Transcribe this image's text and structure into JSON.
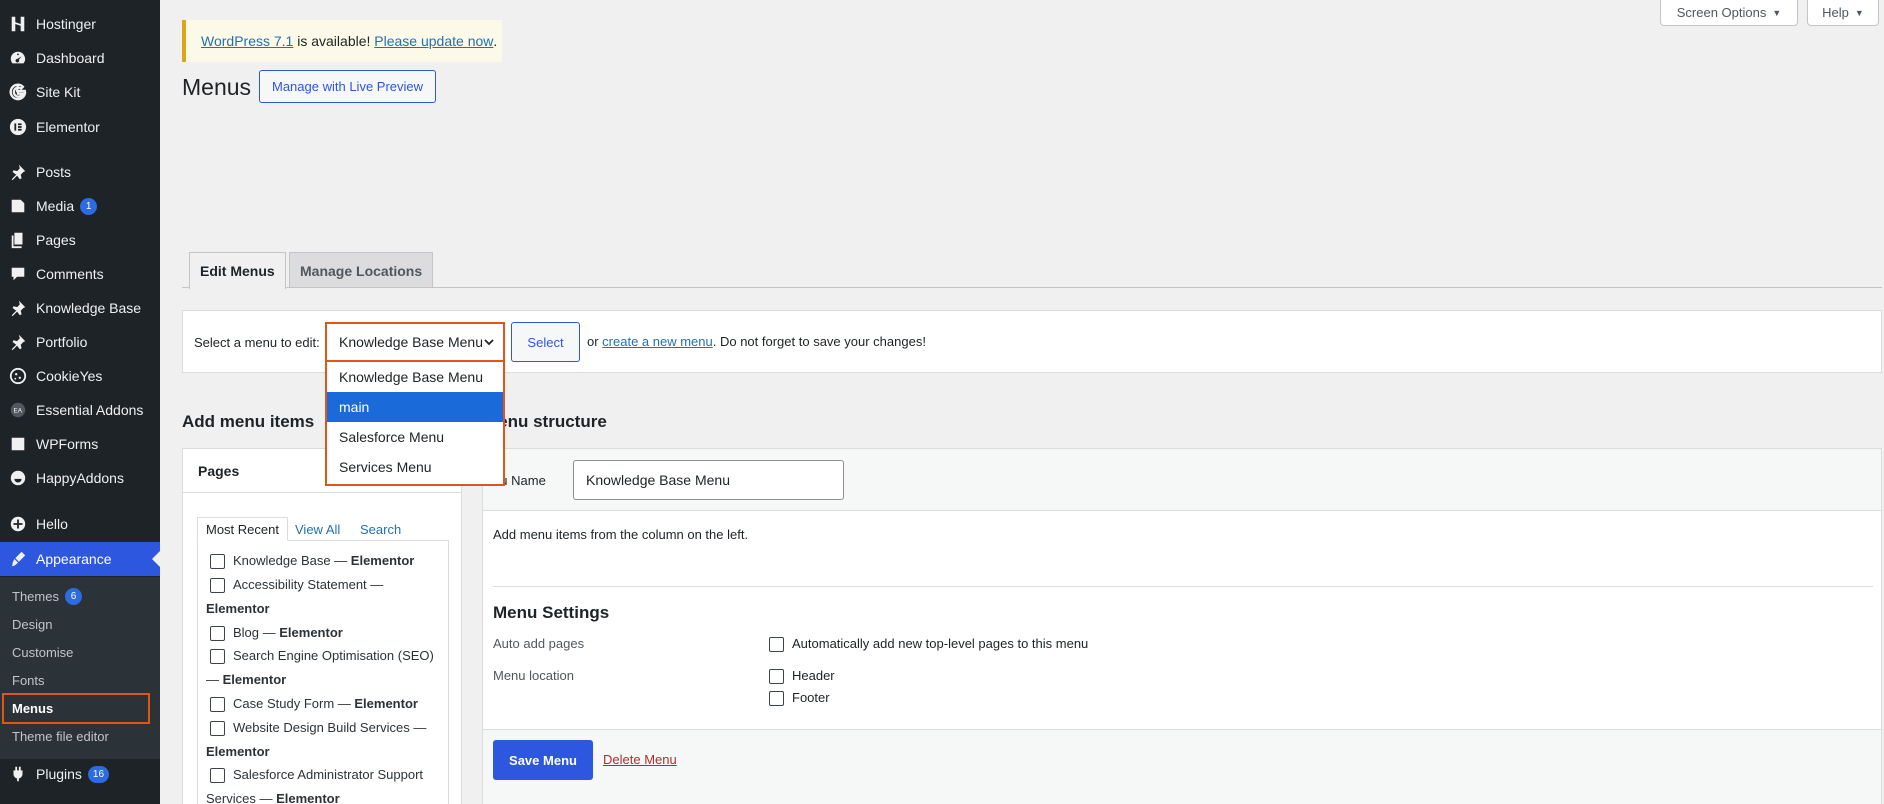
{
  "sidebar": {
    "items": [
      {
        "label": "Hostinger",
        "icon": "hostinger-icon"
      },
      {
        "label": "Dashboard",
        "icon": "dashboard-icon"
      },
      {
        "label": "Site Kit",
        "icon": "google-g-icon"
      },
      {
        "label": "Elementor",
        "icon": "elementor-icon"
      },
      {
        "label": "Posts",
        "icon": "pushpin-icon"
      },
      {
        "label": "Media",
        "icon": "media-icon",
        "badge": "1"
      },
      {
        "label": "Pages",
        "icon": "pages-icon"
      },
      {
        "label": "Comments",
        "icon": "comment-icon"
      },
      {
        "label": "Knowledge Base",
        "icon": "pushpin-icon"
      },
      {
        "label": "Portfolio",
        "icon": "pushpin-icon"
      },
      {
        "label": "CookieYes",
        "icon": "cookie-icon"
      },
      {
        "label": "Essential Addons",
        "icon": "ea-icon"
      },
      {
        "label": "WPForms",
        "icon": "forms-icon"
      },
      {
        "label": "HappyAddons",
        "icon": "happy-icon"
      },
      {
        "label": "Hello",
        "icon": "plus-circle-icon"
      },
      {
        "label": "Appearance",
        "icon": "brush-icon"
      }
    ],
    "submenu": [
      {
        "label": "Themes",
        "badge": "6"
      },
      {
        "label": "Design"
      },
      {
        "label": "Customise"
      },
      {
        "label": "Fonts"
      },
      {
        "label": "Menus"
      },
      {
        "label": "Theme file editor"
      }
    ],
    "plugins": {
      "label": "Plugins",
      "badge": "16",
      "icon": "plugin-icon"
    }
  },
  "screen_options": "Screen Options",
  "help": "Help",
  "notice": {
    "link1": "WordPress 7.1",
    "text": " is available! ",
    "link2": "Please update now",
    "end": "."
  },
  "page_title": "Menus",
  "live_preview": "Manage with Live Preview",
  "tabs": [
    "Edit Menus",
    "Manage Locations"
  ],
  "manage": {
    "label": "Select a menu to edit:",
    "selected": "Knowledge Base Menu",
    "select_btn": "Select",
    "or": "or ",
    "create_link": "create a new menu",
    "tail": ". Do not forget to save your changes!"
  },
  "dropdown": {
    "options": [
      "Knowledge Base Menu",
      "main",
      "Salesforce Menu",
      "Services Menu"
    ],
    "highlighted": "main"
  },
  "add_items": {
    "heading": "Add menu items",
    "pages_title": "Pages",
    "subtabs": [
      "Most Recent",
      "View All",
      "Search"
    ],
    "lines": [
      {
        "cb": true,
        "text": "Knowledge Base — ",
        "bold": "Elementor"
      },
      {
        "cb": true,
        "text": "Accessibility Statement —",
        "bold": ""
      },
      {
        "cb": false,
        "text": "",
        "bold": "Elementor"
      },
      {
        "cb": true,
        "text": "Blog — ",
        "bold": "Elementor"
      },
      {
        "cb": true,
        "text": "Search Engine Optimisation (SEO)",
        "bold": ""
      },
      {
        "cb": false,
        "text": "— ",
        "bold": "Elementor"
      },
      {
        "cb": true,
        "text": "Case Study Form — ",
        "bold": "Elementor"
      },
      {
        "cb": true,
        "text": "Website Design Build Services —",
        "bold": ""
      },
      {
        "cb": false,
        "text": "",
        "bold": "Elementor"
      },
      {
        "cb": true,
        "text": "Salesforce Administrator Support",
        "bold": ""
      },
      {
        "cb": false,
        "text": "Services — ",
        "bold": "Elementor"
      }
    ]
  },
  "structure": {
    "heading": "Menu structure",
    "name_label": "Menu Name",
    "name_value": "Knowledge Base Menu",
    "hint": "Add menu items from the column on the left.",
    "settings_heading": "Menu Settings",
    "auto_add_label": "Auto add pages",
    "auto_add_option": "Automatically add new top-level pages to this menu",
    "location_label": "Menu location",
    "locations": [
      "Header",
      "Footer"
    ],
    "save": "Save Menu",
    "delete": "Delete Menu"
  },
  "colors": {
    "accent": "#2c57de",
    "highlight_border": "#e1551a",
    "sidebar_bg": "#1d2327"
  }
}
